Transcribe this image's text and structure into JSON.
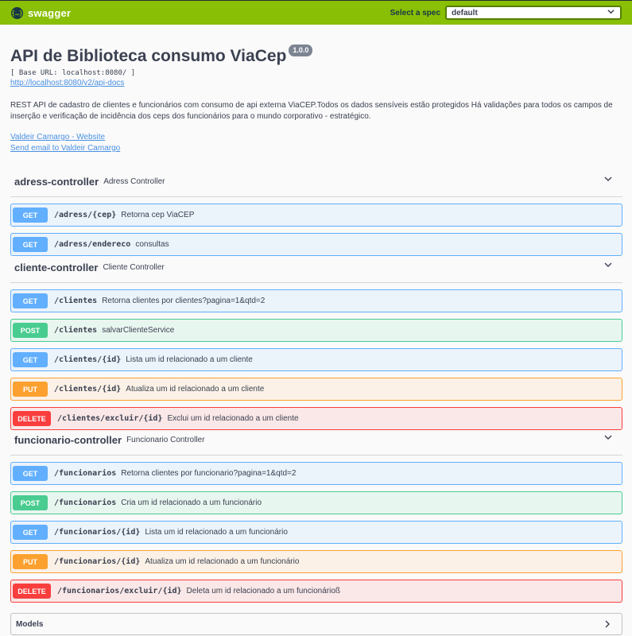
{
  "topbar": {
    "logo_text": "swagger",
    "logo_glyph": "{…}",
    "spec_label": "Select a spec",
    "spec_value": "default"
  },
  "info": {
    "title": "API de Biblioteca consumo ViaCep",
    "version": "1.0.0",
    "base_url": "[ Base URL: localhost:8080/ ]",
    "docs_link": "http://localhost:8080/v2/api-docs",
    "description": "REST API de cadastro de clientes e funcionários com consumo de api externa ViaCEP.Todos os dados sensíveis estão protegidos Há validações para todos os campos de inserção e verificação de incidência dos ceps dos funcionários para o mundo corporativo - estratégico.",
    "contact_website": "Valdeir Camargo - Website",
    "contact_email": "Send email to Valdeir Camargo"
  },
  "tags": [
    {
      "name": "adress-controller",
      "description": "Adress Controller",
      "operations": [
        {
          "method": "GET",
          "path": "/adress/{cep}",
          "summary": "Retorna cep ViaCEP"
        },
        {
          "method": "GET",
          "path": "/adress/endereco",
          "summary": "consultas"
        }
      ]
    },
    {
      "name": "cliente-controller",
      "description": "Cliente Controller",
      "operations": [
        {
          "method": "GET",
          "path": "/clientes",
          "summary": "Retorna clientes por clientes?pagina=1&qtd=2"
        },
        {
          "method": "POST",
          "path": "/clientes",
          "summary": "salvarClienteService"
        },
        {
          "method": "GET",
          "path": "/clientes/{id}",
          "summary": "Lista um id relacionado a um cliente"
        },
        {
          "method": "PUT",
          "path": "/clientes/{id}",
          "summary": "Atualiza um id relacionado a um cliente"
        },
        {
          "method": "DELETE",
          "path": "/clientes/excluir/{id}",
          "summary": "Exclui um id relacionado a um cliente"
        }
      ]
    },
    {
      "name": "funcionario-controller",
      "description": "Funcionario Controller",
      "operations": [
        {
          "method": "GET",
          "path": "/funcionarios",
          "summary": "Retorna clientes por funcionario?pagina=1&qtd=2"
        },
        {
          "method": "POST",
          "path": "/funcionarios",
          "summary": "Cria um id relacionado a um funcionário"
        },
        {
          "method": "GET",
          "path": "/funcionarios/{id}",
          "summary": "Lista um id relacionado a um funcionário"
        },
        {
          "method": "PUT",
          "path": "/funcionarios/{id}",
          "summary": "Atualiza um id relacionado a um funcionário"
        },
        {
          "method": "DELETE",
          "path": "/funcionarios/excluir/{id}",
          "summary": "Deleta um id relacionado a um funcionárioß"
        }
      ]
    }
  ],
  "models": {
    "label": "Models"
  },
  "colors": {
    "topbar": "#89bf04",
    "get": "#61affe",
    "post": "#49cc90",
    "put": "#fca130",
    "delete": "#f93e3e",
    "link": "#4990e2"
  },
  "icons": {
    "tag_toggle": "chevron-down-icon",
    "models_toggle": "chevron-right-icon",
    "spec_toggle": "chevron-down-icon"
  }
}
